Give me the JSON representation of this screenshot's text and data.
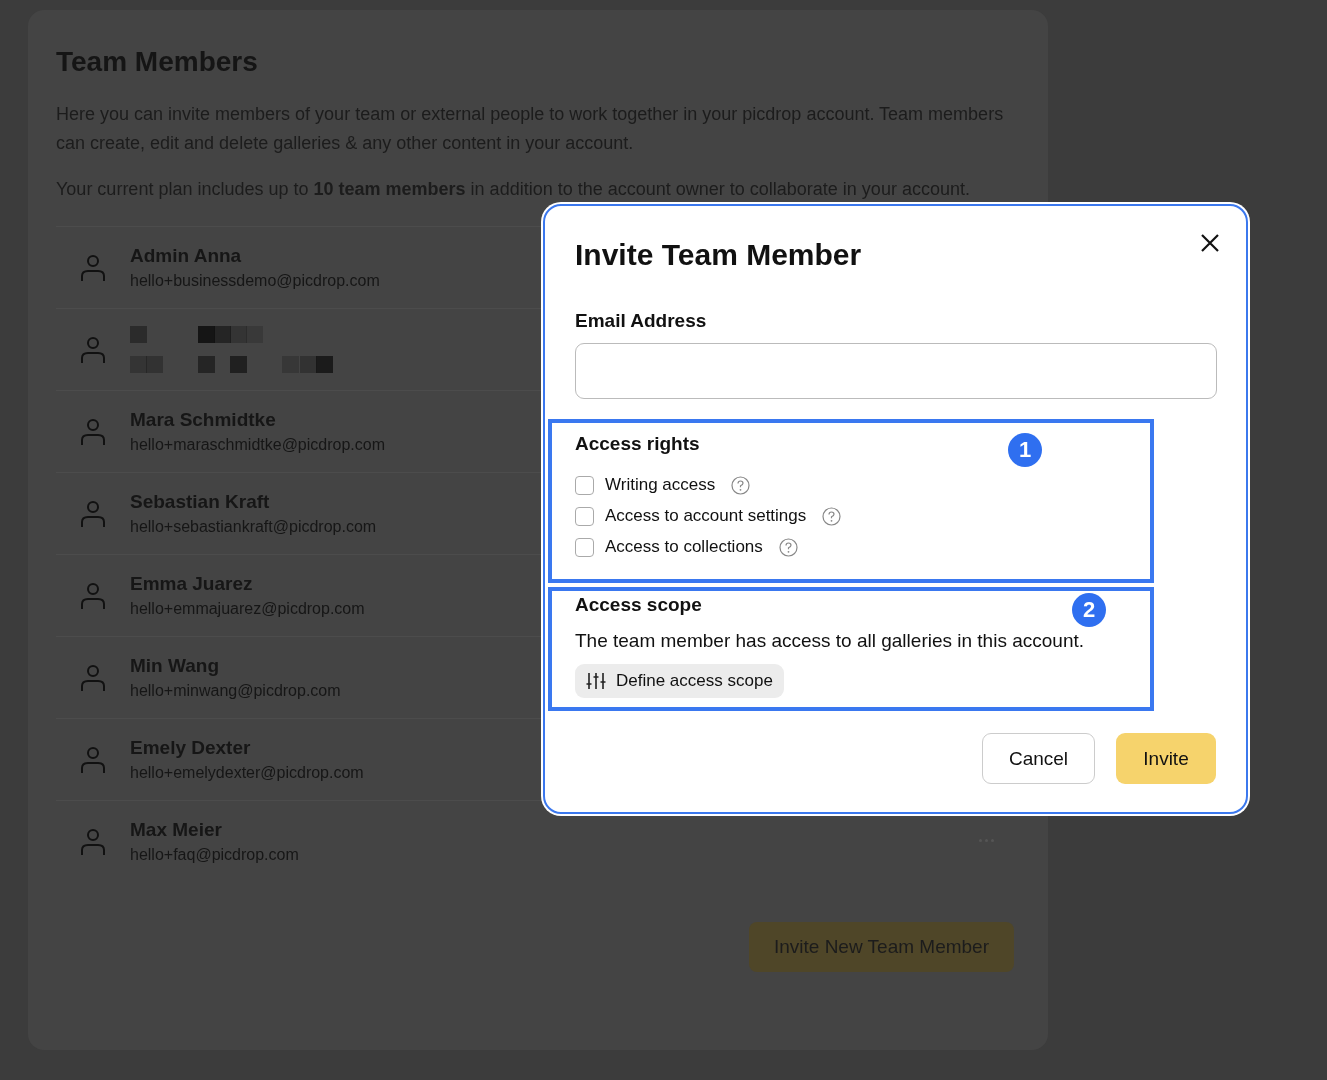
{
  "page": {
    "title": "Team Members",
    "paragraphs": [
      "Here you can invite members of your team or external people to work together in your picdrop account. Team members can create, edit and delete galleries & any other content in your account.",
      "Your current plan includes up to **10 team members** in addition to the account owner to collaborate in your account."
    ],
    "members": [
      {
        "kind": "person",
        "name": "Admin Anna",
        "email": "hello+businessdemo@picdrop.com"
      },
      {
        "kind": "redacted"
      },
      {
        "kind": "person",
        "name": "Mara Schmidtke",
        "email": "hello+maraschmidtke@picdrop.com"
      },
      {
        "kind": "person",
        "name": "Sebastian Kraft",
        "email": "hello+sebastiankraft@picdrop.com"
      },
      {
        "kind": "person",
        "name": "Emma Juarez",
        "email": "hello+emmajuarez@picdrop.com"
      },
      {
        "kind": "person",
        "name": "Min Wang",
        "email": "hello+minwang@picdrop.com"
      },
      {
        "kind": "person",
        "name": "Emely Dexter",
        "email": "hello+emelydexter@picdrop.com"
      },
      {
        "kind": "person",
        "name": "Max Meier",
        "email": "hello+faq@picdrop.com"
      }
    ],
    "invite_button": "Invite New Team Member"
  },
  "modal": {
    "title": "Invite Team Member",
    "email_label": "Email Address",
    "access_rights": {
      "title": "Access rights",
      "badge": "1",
      "options": [
        {
          "label": "Writing access",
          "checked": false
        },
        {
          "label": "Access to account settings",
          "checked": false
        },
        {
          "label": "Access to collections",
          "checked": false
        }
      ]
    },
    "access_scope": {
      "title": "Access scope",
      "badge": "2",
      "text": "The team member has access to all galleries in this account.",
      "button": "Define access scope"
    },
    "cancel": "Cancel",
    "invite": "Invite"
  }
}
